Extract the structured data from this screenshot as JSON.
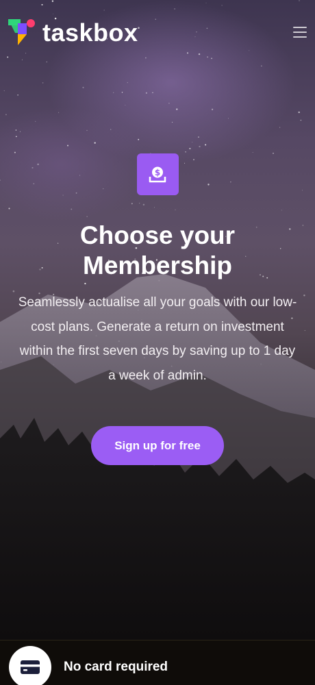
{
  "header": {
    "logo_text": "taskbox",
    "logo_icon": "taskbox-logo-mark",
    "menu_icon": "hamburger-menu-icon"
  },
  "hero": {
    "feature_icon": "money-deposit-icon",
    "headline": "Choose your Membership",
    "subtext": "Seamlessly actualise all your goals with our low-cost plans. Generate a return on investment within the first seven days by saving up to 1 day a week of admin.",
    "cta_label": "Sign up for free"
  },
  "footer": {
    "icon": "credit-card-icon",
    "text": "No card required"
  },
  "colors": {
    "accent": "#9b5df4",
    "logo_green": "#2fd67b",
    "logo_pink": "#ff3d6e",
    "logo_purple": "#7c4dff",
    "logo_orange": "#ffb300",
    "card_icon_navy": "#1c1f3a"
  }
}
